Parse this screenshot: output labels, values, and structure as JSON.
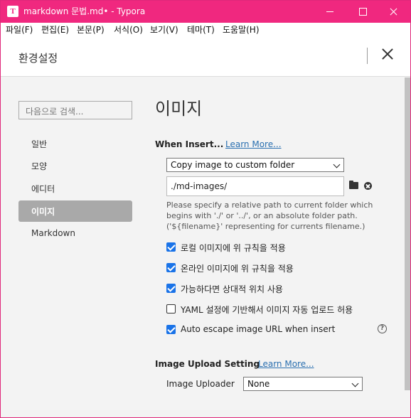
{
  "window": {
    "title": "markdown 문법.md• - Typora",
    "app_icon_letter": "T",
    "accent_color": "#f0287f"
  },
  "menu": [
    {
      "label": "파일(F)"
    },
    {
      "label": "편집(E)"
    },
    {
      "label": "본문(P)"
    },
    {
      "label": "서식(O)"
    },
    {
      "label": "보기(V)"
    },
    {
      "label": "테마(T)"
    },
    {
      "label": "도움말(H)"
    }
  ],
  "header": {
    "title": "환경설정"
  },
  "sidebar": {
    "search_placeholder": "다음으로 검색...",
    "items": [
      {
        "label": "일반"
      },
      {
        "label": "모양"
      },
      {
        "label": "에디터"
      },
      {
        "label": "이미지",
        "active": true
      },
      {
        "label": "Markdown"
      }
    ]
  },
  "page": {
    "title": "이미지",
    "when_insert": {
      "title": "When Insert...",
      "learn_more": "Learn More...",
      "action_value": "Copy image to custom folder",
      "path_value": "./md-images/",
      "help_lines": [
        " Please specify a relative path to current folder which",
        "begins with './' or '../', or an absolute folder path.",
        "('${filename}' representing for currents filename.)"
      ]
    },
    "options": [
      {
        "label": "로컬 이미지에 위 규칙을 적용",
        "checked": true
      },
      {
        "label": "온라인 이미지에 위 규칙을 적용",
        "checked": true
      },
      {
        "label": "가능하다면 상대적 위치 사용",
        "checked": true
      },
      {
        "label": "YAML 설정에 기반해서 이미지 자동 업로드 허용",
        "checked": false
      },
      {
        "label": "Auto escape image URL when insert",
        "checked": true
      }
    ],
    "help_icon": "?",
    "upload": {
      "title": "Image Upload Setting",
      "learn_more": "Learn More...",
      "uploader_label": "Image Uploader",
      "uploader_value": "None"
    }
  }
}
